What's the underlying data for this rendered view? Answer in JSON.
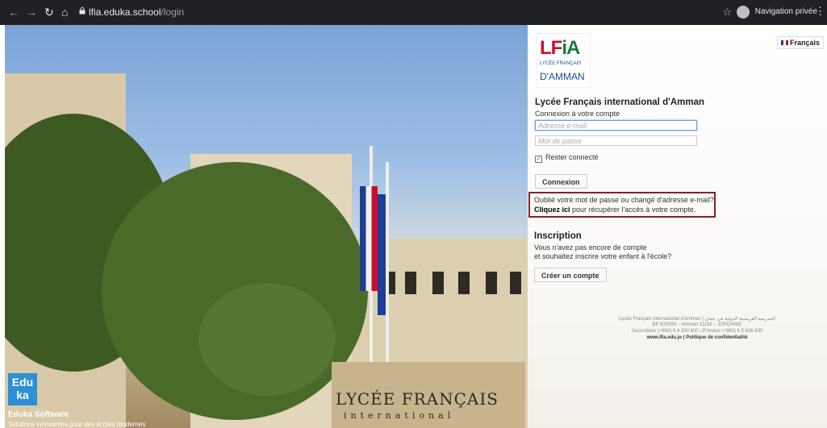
{
  "browser": {
    "url_host": "lfia.eduka.school",
    "url_path": "/login",
    "private_label": "Navigation privée"
  },
  "hero": {
    "sign_line1": "LYCÉE FRANÇAIS",
    "sign_line2": "international",
    "eduka_logo_line1": "Edu",
    "eduka_logo_line2": "ka",
    "eduka_name": "Eduka Software",
    "eduka_tagline": "Solutions innovantes pour des écoles modernes"
  },
  "panel": {
    "language": "Français",
    "logo_text": "LFiA",
    "logo_sub1": "LYCÉE FRANÇAIS",
    "logo_sub2": "D'AMMAN",
    "title": "Lycée Français international d'Amman",
    "subtitle": "Connexion à votre compte",
    "email_placeholder": "Adresse e-mail",
    "password_placeholder": "Mot de passe",
    "remember_label": "Rester connecté",
    "login_button": "Connexion",
    "forgot_line1": "Oublié votre mot de passe ou changé d'adresse e-mail?",
    "forgot_link": "Cliquez ici",
    "forgot_line2_rest": " pour récupérer l'accès à votre compte.",
    "signup_title": "Inscription",
    "signup_line1": "Vous n'avez pas encore de compte",
    "signup_line2": "et souhaitez inscrire votre enfant à l'école?",
    "signup_button": "Créer un compte",
    "footer_line1": "Lycée Français international d'Amman | المدرسة الفرنسية الدولية في عمان",
    "footer_line2": "BP 830099 – Amman 11183 – JORDANIE",
    "footer_line3": "Secondaire (+962) 6 4 300 600 | Primaire (+962) 6 5 826 830",
    "footer_site": "www.lfia.edu.jo",
    "footer_privacy": "Politique de confidentialité"
  }
}
